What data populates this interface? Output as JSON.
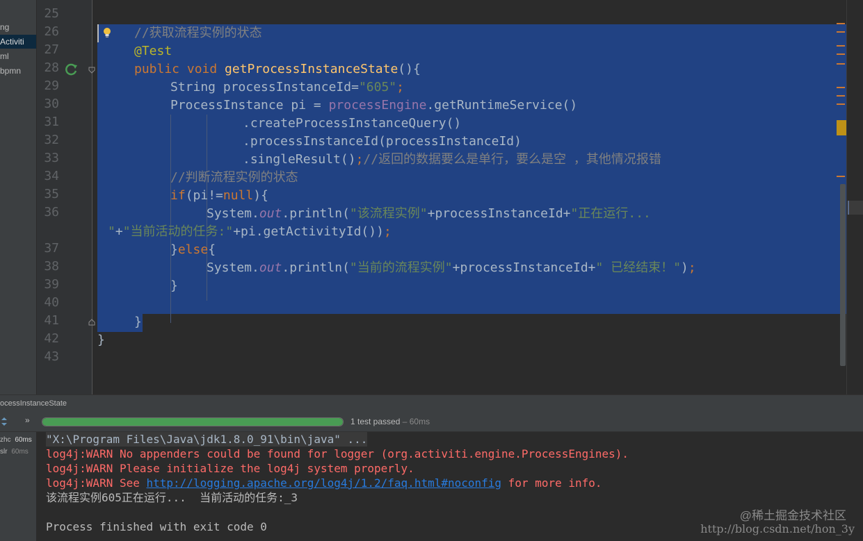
{
  "project": {
    "items": [
      {
        "label": "ng"
      },
      {
        "label": "Activiti"
      },
      {
        "label": "ml"
      },
      {
        "label": "bpmn"
      }
    ]
  },
  "editor": {
    "line_numbers": [
      "25",
      "26",
      "27",
      "28",
      "29",
      "30",
      "31",
      "32",
      "33",
      "34",
      "35",
      "36",
      "",
      "37",
      "38",
      "39",
      "40",
      "41",
      "42",
      "43"
    ],
    "lines": [
      [],
      [
        {
          "t": "//获取流程实例的状态",
          "c": "cmt"
        }
      ],
      [
        {
          "t": "@Test",
          "c": "ann"
        }
      ],
      [
        {
          "t": "public void ",
          "c": "kw"
        },
        {
          "t": "getProcessInstanceState",
          "c": "fn"
        },
        {
          "t": "(){",
          "c": "plain"
        }
      ],
      [
        {
          "t": "String processInstanceId=",
          "c": "plain"
        },
        {
          "t": "\"605\"",
          "c": "str"
        },
        {
          "t": ";",
          "c": "kw"
        }
      ],
      [
        {
          "t": "ProcessInstance pi = ",
          "c": "plain"
        },
        {
          "t": "processEngine",
          "c": "field"
        },
        {
          "t": ".getRuntimeService()",
          "c": "plain"
        }
      ],
      [
        {
          "t": ".createProcessInstanceQuery()",
          "c": "plain"
        }
      ],
      [
        {
          "t": ".processInstanceId(processInstanceId)",
          "c": "plain"
        }
      ],
      [
        {
          "t": ".singleResult()",
          "c": "plain"
        },
        {
          "t": ";",
          "c": "kw"
        },
        {
          "t": "//返回的数据要么是单行，要么是空 ，其他情况报错",
          "c": "cmt"
        }
      ],
      [
        {
          "t": "//判断流程实例的状态",
          "c": "cmt"
        }
      ],
      [
        {
          "t": "if",
          "c": "kw"
        },
        {
          "t": "(pi!=",
          "c": "plain"
        },
        {
          "t": "null",
          "c": "kw"
        },
        {
          "t": "){",
          "c": "plain"
        }
      ],
      [
        {
          "t": "System.",
          "c": "plain"
        },
        {
          "t": "out",
          "c": "static"
        },
        {
          "t": ".println(",
          "c": "plain"
        },
        {
          "t": "\"该流程实例\"",
          "c": "str"
        },
        {
          "t": "+processInstanceId+",
          "c": "plain"
        },
        {
          "t": "\"正在运行...",
          "c": "str"
        }
      ],
      [
        {
          "t": "\"",
          "c": "str"
        },
        {
          "t": "+",
          "c": "plain"
        },
        {
          "t": "\"当前活动的任务:\"",
          "c": "str"
        },
        {
          "t": "+pi.getActivityId())",
          "c": "plain"
        },
        {
          "t": ";",
          "c": "kw"
        }
      ],
      [
        {
          "t": "}",
          "c": "plain"
        },
        {
          "t": "else",
          "c": "kw"
        },
        {
          "t": "{",
          "c": "plain"
        }
      ],
      [
        {
          "t": "System.",
          "c": "plain"
        },
        {
          "t": "out",
          "c": "static"
        },
        {
          "t": ".println(",
          "c": "plain"
        },
        {
          "t": "\"当前的流程实例\"",
          "c": "str"
        },
        {
          "t": "+processInstanceId+",
          "c": "plain"
        },
        {
          "t": "\" 已经结束！\"",
          "c": "str"
        },
        {
          "t": ")",
          "c": "plain"
        },
        {
          "t": ";",
          "c": "kw"
        }
      ],
      [
        {
          "t": "}",
          "c": "plain"
        }
      ],
      [],
      [
        {
          "t": "}",
          "c": "plain"
        }
      ],
      [
        {
          "t": "}",
          "c": "plain"
        }
      ],
      []
    ]
  },
  "run_panel": {
    "title": "ocessInstanceState",
    "progress_fraction": 1.0,
    "status": "1 test passed",
    "status_time": " – 60ms",
    "tests": [
      {
        "name": "zhc",
        "time": "60ms"
      },
      {
        "name": "slr",
        "time": "60ms"
      }
    ],
    "console": {
      "cmd": "\"X:\\Program Files\\Java\\jdk1.8.0_91\\bin\\java\" ...",
      "warn1": "log4j:WARN No appenders could be found for logger (org.activiti.engine.ProcessEngines).",
      "warn2": "log4j:WARN Please initialize the log4j system properly.",
      "warn3_prefix": "log4j:WARN See ",
      "warn3_link": "http://logging.apache.org/log4j/1.2/faq.html#noconfig",
      "warn3_suffix": " for more info.",
      "output": "该流程实例605正在运行...  当前活动的任务:_3",
      "exit": "Process finished with exit code 0"
    }
  },
  "watermark": {
    "line1": "@稀土掘金技术社区",
    "line2": "http://blog.csdn.net/hon_3y"
  },
  "colors": {
    "selection": "#214283",
    "keyword": "#cc7832",
    "string": "#6a8759",
    "comment": "#808080",
    "error": "#ff6b68",
    "progress": "#499c54"
  }
}
